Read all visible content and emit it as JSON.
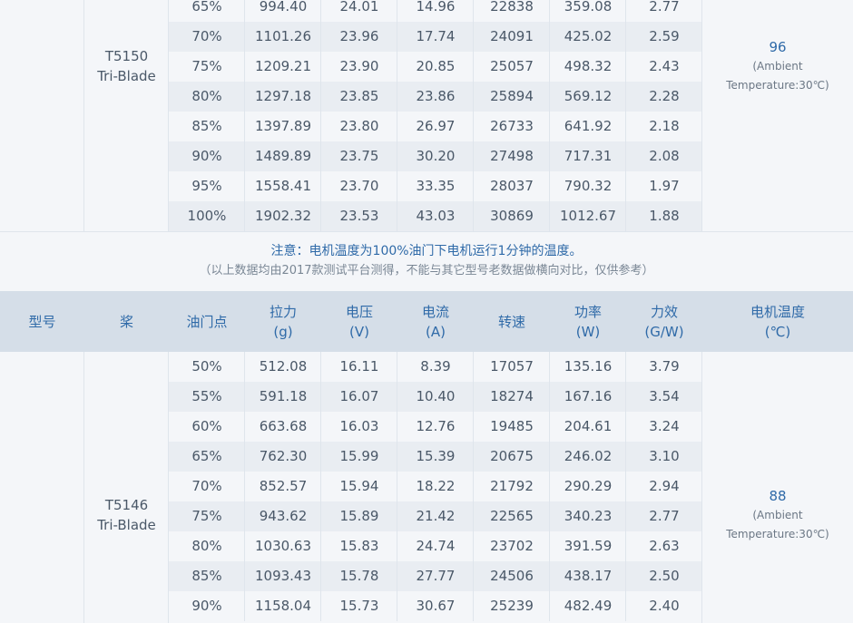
{
  "upper": {
    "model_line1": "T5150",
    "model_line2": "Tri-Blade",
    "temp_value": "96",
    "temp_note1": "(Ambient",
    "temp_note2": "Temperature:30℃)",
    "rows": [
      [
        "65%",
        "994.40",
        "24.01",
        "14.96",
        "22838",
        "359.08",
        "2.77"
      ],
      [
        "70%",
        "1101.26",
        "23.96",
        "17.74",
        "24091",
        "425.02",
        "2.59"
      ],
      [
        "75%",
        "1209.21",
        "23.90",
        "20.85",
        "25057",
        "498.32",
        "2.43"
      ],
      [
        "80%",
        "1297.18",
        "23.85",
        "23.86",
        "25894",
        "569.12",
        "2.28"
      ],
      [
        "85%",
        "1397.89",
        "23.80",
        "26.97",
        "26733",
        "641.92",
        "2.18"
      ],
      [
        "90%",
        "1489.89",
        "23.75",
        "30.20",
        "27498",
        "717.31",
        "2.08"
      ],
      [
        "95%",
        "1558.41",
        "23.70",
        "33.35",
        "28037",
        "790.32",
        "1.97"
      ],
      [
        "100%",
        "1902.32",
        "23.53",
        "43.03",
        "30869",
        "1012.67",
        "1.88"
      ]
    ]
  },
  "note": {
    "main": "注意：电机温度为100%油门下电机运行1分钟的温度。",
    "sub": "（以上数据均由2017款测试平台测得，不能与其它型号老数据做横向对比，仅供参考）"
  },
  "header": {
    "model": "型号",
    "prop": "桨",
    "throttle": "油门点",
    "thrust": "拉力",
    "thrust_unit": "(g)",
    "voltage": "电压",
    "voltage_unit": "(V)",
    "current": "电流",
    "current_unit": "(A)",
    "rpm": "转速",
    "power": "功率",
    "power_unit": "(W)",
    "efficiency": "力效",
    "efficiency_unit": "(G/W)",
    "motor_temp": "电机温度",
    "motor_temp_unit": "(℃)"
  },
  "lower": {
    "model_line1": "T5146",
    "model_line2": "Tri-Blade",
    "temp_value": "88",
    "temp_note1": "(Ambient",
    "temp_note2": "Temperature:30℃)",
    "rows": [
      [
        "50%",
        "512.08",
        "16.11",
        "8.39",
        "17057",
        "135.16",
        "3.79"
      ],
      [
        "55%",
        "591.18",
        "16.07",
        "10.40",
        "18274",
        "167.16",
        "3.54"
      ],
      [
        "60%",
        "663.68",
        "16.03",
        "12.76",
        "19485",
        "204.61",
        "3.24"
      ],
      [
        "65%",
        "762.30",
        "15.99",
        "15.39",
        "20675",
        "246.02",
        "3.10"
      ],
      [
        "70%",
        "852.57",
        "15.94",
        "18.22",
        "21792",
        "290.29",
        "2.94"
      ],
      [
        "75%",
        "943.62",
        "15.89",
        "21.42",
        "22565",
        "340.23",
        "2.77"
      ],
      [
        "80%",
        "1030.63",
        "15.83",
        "24.74",
        "23702",
        "391.59",
        "2.63"
      ],
      [
        "85%",
        "1093.43",
        "15.78",
        "27.77",
        "24506",
        "438.17",
        "2.50"
      ],
      [
        "90%",
        "1158.04",
        "15.73",
        "30.67",
        "25239",
        "482.49",
        "2.40"
      ]
    ]
  }
}
